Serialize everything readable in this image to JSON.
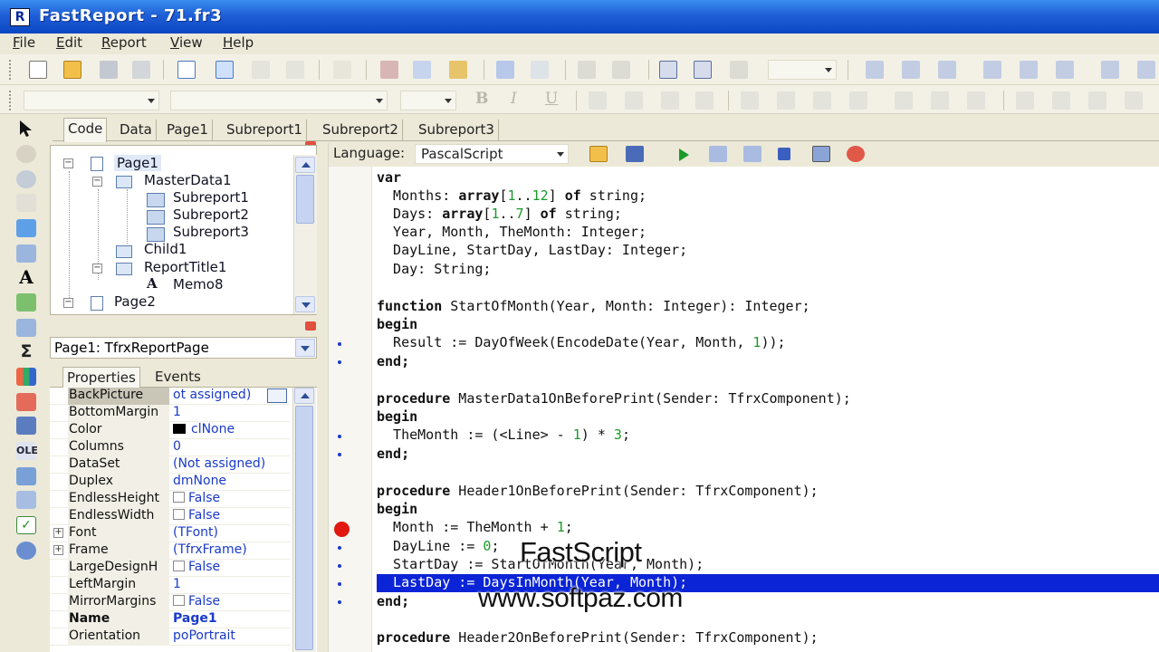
{
  "window": {
    "title": "FastReport - 71.fr3",
    "app_icon": "R"
  },
  "menu": [
    {
      "u": "F",
      "rest": "ile"
    },
    {
      "u": "E",
      "rest": "dit"
    },
    {
      "u": "R",
      "rest": "eport"
    },
    {
      "u": "V",
      "rest": "iew"
    },
    {
      "u": "H",
      "rest": "elp"
    }
  ],
  "format_toolbar": {
    "bold": "B",
    "italic": "I",
    "underline": "U"
  },
  "tabs": [
    "Code",
    "Data",
    "Page1",
    "Subreport1",
    "Subreport2",
    "Subreport3"
  ],
  "active_tab": "Code",
  "tree": {
    "expander_open": "−",
    "items": [
      "Page1",
      "MasterData1",
      "Subreport1",
      "Subreport2",
      "Subreport3",
      "Child1",
      "ReportTitle1",
      "Memo8",
      "Page2"
    ],
    "memo_glyph": "A"
  },
  "object_selector": {
    "value": "Page1: TfrxReportPage"
  },
  "inspector_tabs": [
    "Properties",
    "Events"
  ],
  "properties": [
    {
      "name": "BackPicture",
      "value": "ot assigned)",
      "kind": "selected"
    },
    {
      "name": "BottomMargin",
      "value": "1"
    },
    {
      "name": "Color",
      "value": "clNone",
      "kind": "color"
    },
    {
      "name": "Columns",
      "value": "0"
    },
    {
      "name": "DataSet",
      "value": "(Not assigned)"
    },
    {
      "name": "Duplex",
      "value": "dmNone"
    },
    {
      "name": "EndlessHeight",
      "value": "False",
      "kind": "check"
    },
    {
      "name": "EndlessWidth",
      "value": "False",
      "kind": "check"
    },
    {
      "name": "Font",
      "value": "(TFont)",
      "kind": "expand"
    },
    {
      "name": "Frame",
      "value": "(TfrxFrame)",
      "kind": "expand"
    },
    {
      "name": "LargeDesignH",
      "value": "False",
      "kind": "check"
    },
    {
      "name": "LeftMargin",
      "value": "1"
    },
    {
      "name": "MirrorMargins",
      "value": "False",
      "kind": "check"
    },
    {
      "name": "Name",
      "value": "Page1",
      "kind": "bold"
    },
    {
      "name": "Orientation",
      "value": "poPortrait"
    }
  ],
  "prop_expand_glyph": "+",
  "code_toolbar": {
    "language_label": "Language:",
    "language_value": "PascalScript"
  },
  "code": {
    "l1": "var",
    "l2a": "  Months: ",
    "l2k": "array",
    "l2b": "[",
    "l2n1": "1",
    "l2c": "..",
    "l2n2": "12",
    "l2d": "] ",
    "l2k2": "of",
    "l2e": " string;",
    "l3a": "  Days: ",
    "l3k": "array",
    "l3b": "[",
    "l3n1": "1",
    "l3c": "..",
    "l3n2": "7",
    "l3d": "] ",
    "l3k2": "of",
    "l3e": " string;",
    "l4": "  Year, Month, TheMonth: Integer;",
    "l5": "  DayLine, StartDay, LastDay: Integer;",
    "l6": "  Day: String;",
    "l7k": "function",
    "l7": " StartOfMonth(Year, Month: Integer): Integer;",
    "l8": "begin",
    "l9a": "  Result := DayOfWeek(EncodeDate(Year, Month, ",
    "l9n": "1",
    "l9b": "));",
    "l10": "end;",
    "l11k": "procedure",
    "l11": " MasterData1OnBeforePrint(Sender: TfrxComponent);",
    "l12": "begin",
    "l13a": "  TheMonth := (<Line> - ",
    "l13n": "1",
    "l13b": ") * ",
    "l13n2": "3",
    "l13c": ";",
    "l14": "end;",
    "l15k": "procedure",
    "l15": " Header1OnBeforePrint(Sender: TfrxComponent);",
    "l16": "begin",
    "l17a": "  Month := TheMonth + ",
    "l17n": "1",
    "l17b": ";",
    "l18a": "  DayLine := ",
    "l18n": "0",
    "l18b": ";",
    "l19": "  StartDay := StartOfMonth(Year, Month);",
    "l20": "  LastDay := DaysInMonth(Year, Month);",
    "l21": "end;",
    "l22k": "procedure",
    "l22": " Header2OnBeforePrint(Sender: TfrxComponent);"
  },
  "watermark": {
    "title": "FastScript",
    "url": "www.softpaz.com"
  },
  "colors": {
    "titlebar": "#1f5fd6",
    "selection": "#0b24d6",
    "breakpoint": "#e01810",
    "property_value": "#1a3ac9"
  }
}
